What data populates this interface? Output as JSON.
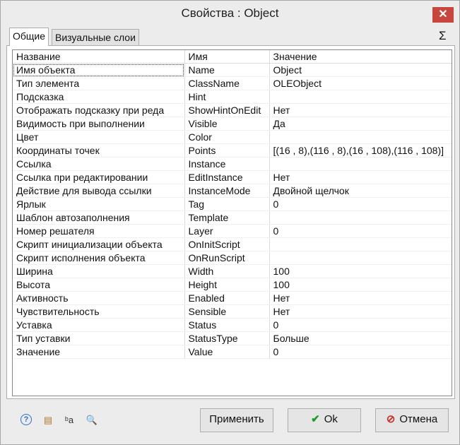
{
  "window": {
    "title": "Свойства : Object",
    "close_glyph": "✕"
  },
  "tabs": [
    {
      "label": "Общие",
      "active": true
    },
    {
      "label": "Визуальные слои",
      "active": false
    }
  ],
  "sigma_glyph": "Σ",
  "grid": {
    "headers": [
      "Название",
      "Имя",
      "Значение"
    ],
    "rows": [
      [
        "Имя объекта",
        "Name",
        "Object"
      ],
      [
        "Тип элемента",
        "ClassName",
        "OLEObject"
      ],
      [
        "Подсказка",
        "Hint",
        ""
      ],
      [
        "Отображать подсказку при реда",
        "ShowHintOnEdit",
        "Нет"
      ],
      [
        "Видимость при выполнении",
        "Visible",
        "Да"
      ],
      [
        "Цвет",
        "Color",
        ""
      ],
      [
        "Координаты точек",
        "Points",
        "[(16 , 8),(116 , 8),(16 , 108),(116 , 108)]"
      ],
      [
        "Ссылка",
        "Instance",
        ""
      ],
      [
        "Ссылка при редактировании",
        "EditInstance",
        "Нет"
      ],
      [
        "Действие для вывода ссылки",
        "InstanceMode",
        "Двойной щелчок"
      ],
      [
        "Ярлык",
        "Tag",
        "0"
      ],
      [
        "Шаблон автозаполнения",
        "Template",
        ""
      ],
      [
        "Номер решателя",
        "Layer",
        "0"
      ],
      [
        "Скрипт инициализации объекта",
        "OnInitScript",
        ""
      ],
      [
        "Скрипт исполнения объекта",
        "OnRunScript",
        ""
      ],
      [
        "Ширина",
        "Width",
        "100"
      ],
      [
        "Высота",
        "Height",
        "100"
      ],
      [
        "Активность",
        "Enabled",
        "Нет"
      ],
      [
        "Чувствительность",
        "Sensible",
        "Нет"
      ],
      [
        "Уставка",
        "Status",
        "0"
      ],
      [
        "Тип уставки",
        "StatusType",
        "Больше"
      ],
      [
        "Значение",
        "Value",
        "0"
      ]
    ]
  },
  "toolbar_icons": [
    {
      "name": "help-icon",
      "glyph": "?",
      "color": "#2a6fd6"
    },
    {
      "name": "properties-icon",
      "glyph": "▤",
      "color": "#b07a2a"
    },
    {
      "name": "rename-icon",
      "glyph": "ᵇa",
      "color": "#333333"
    },
    {
      "name": "search-icon",
      "glyph": "🔍",
      "color": "#888888"
    }
  ],
  "buttons": {
    "apply_label": "Применить",
    "ok_label": "Ok",
    "ok_glyph": "✔",
    "cancel_label": "Отмена",
    "cancel_glyph": "⊘"
  }
}
